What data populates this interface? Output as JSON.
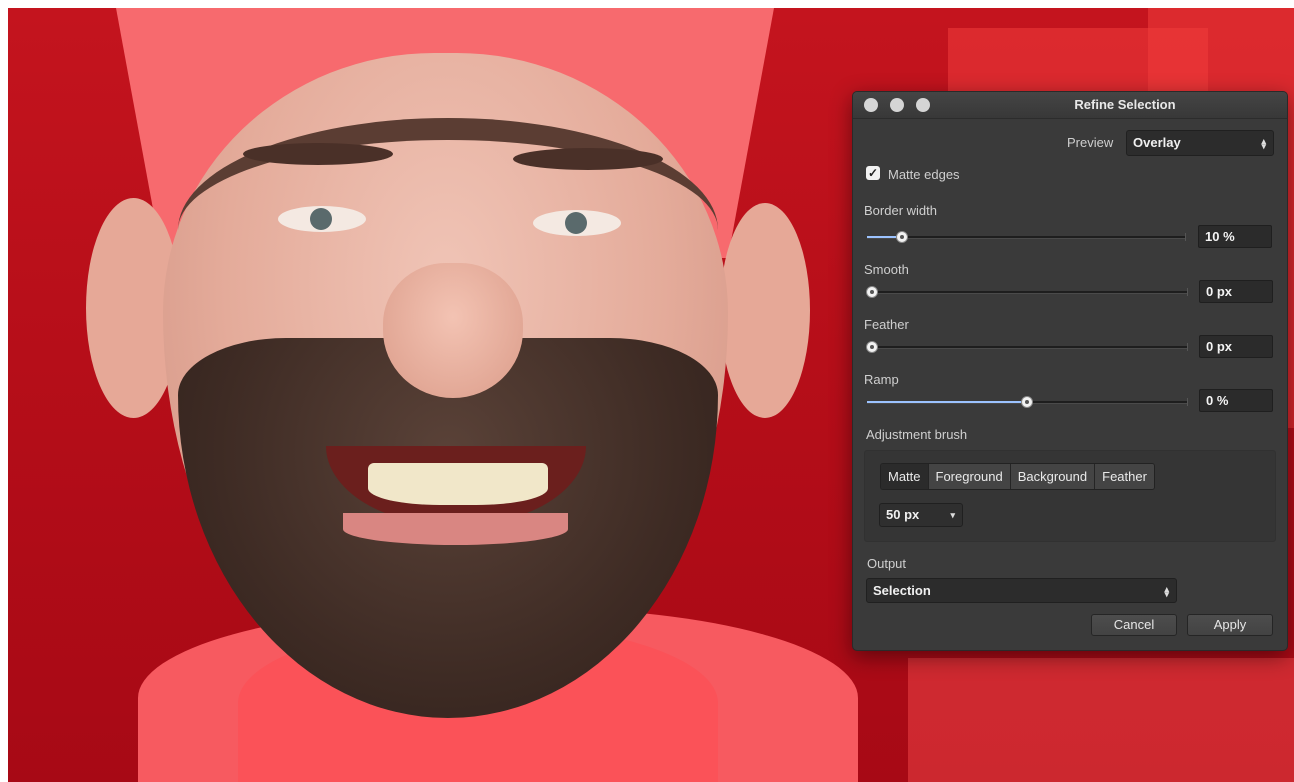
{
  "dialog": {
    "title": "Refine Selection",
    "preview": {
      "label": "Preview",
      "value": "Overlay"
    },
    "matte_edges": {
      "label": "Matte edges",
      "checked": true,
      "check_glyph": "✓"
    },
    "sliders": [
      {
        "label": "Border width",
        "value": "10 %",
        "level": 0.11
      },
      {
        "label": "Smooth",
        "value": "0 px",
        "level": 0.0
      },
      {
        "label": "Feather",
        "value": "0 px",
        "level": 0.0
      },
      {
        "label": "Ramp",
        "value": "0 %",
        "level": 0.5
      }
    ],
    "adjustment_brush": {
      "label": "Adjustment brush",
      "modes": [
        "Matte",
        "Foreground",
        "Background",
        "Feather"
      ],
      "active_mode": "Matte",
      "brush_size": "50 px",
      "dropdown_glyph": "▾"
    },
    "output": {
      "label": "Output",
      "value": "Selection"
    },
    "buttons": {
      "cancel": "Cancel",
      "apply": "Apply"
    },
    "stepper_glyph": "▴▾"
  },
  "colors": {
    "overlay": "#c4141e",
    "slider_fill": "#9cc3ff",
    "dialog_bg": "#3a3a3a"
  }
}
